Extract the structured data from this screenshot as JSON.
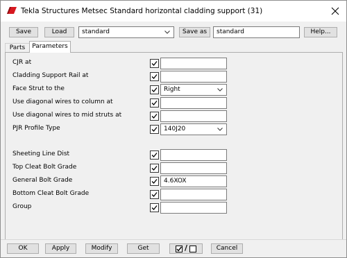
{
  "window": {
    "title": "Tekla Structures  Metsec Standard horizontal cladding support (31)"
  },
  "toolbar": {
    "save_label": "Save",
    "load_label": "Load",
    "preset_value": "standard",
    "save_as_label": "Save as",
    "save_as_value": "standard",
    "help_label": "Help..."
  },
  "tabs": [
    {
      "label": "Parts",
      "active": false
    },
    {
      "label": "Parameters",
      "active": true
    }
  ],
  "params": [
    {
      "label": "CJR at",
      "checked": true,
      "control": "field",
      "value": ""
    },
    {
      "label": "Cladding Support Rail at",
      "checked": true,
      "control": "field",
      "value": ""
    },
    {
      "label": "Face Strut to the",
      "checked": true,
      "control": "combo",
      "value": "Right"
    },
    {
      "label": "Use diagonal wires to column at",
      "checked": true,
      "control": "field",
      "value": ""
    },
    {
      "label": "Use diagonal wires to mid struts at",
      "checked": true,
      "control": "field",
      "value": ""
    },
    {
      "label": "PJR Profile Type",
      "checked": true,
      "control": "combo",
      "value": "140J20"
    },
    {
      "label": "Sheeting Line Dist",
      "checked": true,
      "control": "field",
      "value": ""
    },
    {
      "label": "Top Cleat Bolt Grade",
      "checked": true,
      "control": "field",
      "value": ""
    },
    {
      "label": "General Bolt Grade",
      "checked": true,
      "control": "field",
      "value": "4.6XOX"
    },
    {
      "label": "Bottom Cleat Bolt Grade",
      "checked": true,
      "control": "field",
      "value": ""
    },
    {
      "label": "Group",
      "checked": true,
      "control": "field",
      "value": ""
    }
  ],
  "footer": {
    "ok_label": "OK",
    "apply_label": "Apply",
    "modify_label": "Modify",
    "get_label": "Get",
    "toggle_separator": "/",
    "cancel_label": "Cancel"
  },
  "icons": {
    "app": "tekla-logo-icon",
    "close": "close-icon",
    "dropdown": "chevron-down-icon",
    "check": "checkmark-icon"
  },
  "colors": {
    "brand_red": "#d71920",
    "button_face": "#e1e1e1",
    "window_bg": "#f0f0f0"
  }
}
